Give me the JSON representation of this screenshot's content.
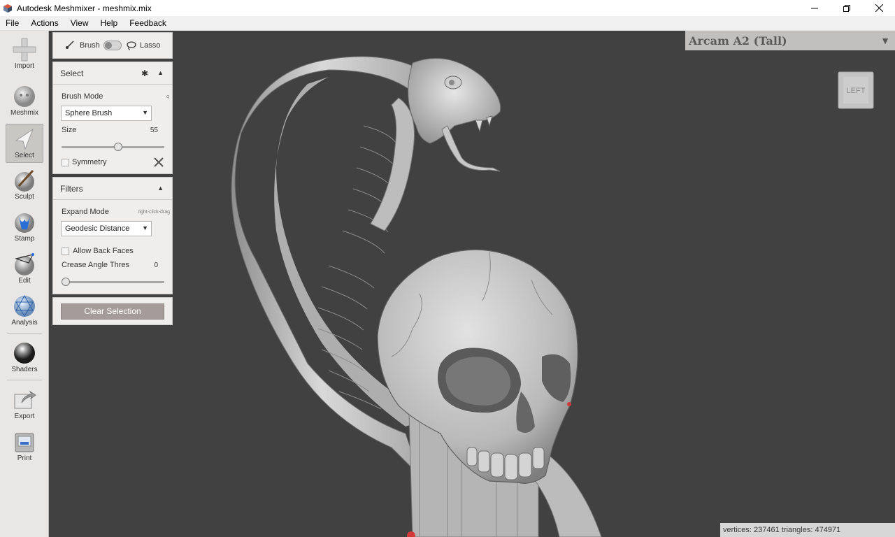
{
  "window": {
    "title": "Autodesk Meshmixer - meshmix.mix",
    "controls": [
      "minimize",
      "restore",
      "close"
    ]
  },
  "menu": [
    "File",
    "Actions",
    "View",
    "Help",
    "Feedback"
  ],
  "toolbar": {
    "tools": [
      {
        "label": "Import",
        "icon": "plus-icon"
      },
      {
        "label": "Meshmix",
        "icon": "meshmix-head-icon"
      },
      {
        "label": "Select",
        "icon": "cursor-arrow-icon",
        "active": true
      },
      {
        "label": "Sculpt",
        "icon": "brush-sphere-icon"
      },
      {
        "label": "Stamp",
        "icon": "stamp-icon"
      },
      {
        "label": "Edit",
        "icon": "edit-sphere-icon"
      },
      {
        "label": "Analysis",
        "icon": "analysis-sphere-icon"
      },
      {
        "label": "Shaders",
        "icon": "shader-sphere-icon"
      },
      {
        "label": "Export",
        "icon": "export-icon"
      },
      {
        "label": "Print",
        "icon": "printer-icon"
      }
    ]
  },
  "brush_toggle": {
    "left": "Brush",
    "right": "Lasso"
  },
  "select_panel": {
    "title": "Select",
    "brush_mode_label": "Brush Mode",
    "brush_mode_hotkey": "q",
    "brush_mode_value": "Sphere Brush",
    "size_label": "Size",
    "size_value": "55",
    "size_fraction": 0.55,
    "symmetry_label": "Symmetry",
    "symmetry_checked": false
  },
  "filters_panel": {
    "title": "Filters",
    "expand_mode_label": "Expand Mode",
    "expand_mode_hint": "right-click-drag",
    "expand_mode_value": "Geodesic Distance",
    "allow_back_faces_label": "Allow Back Faces",
    "allow_back_faces_checked": false,
    "crease_label": "Crease Angle Thres",
    "crease_value": "0",
    "crease_fraction": 0.0
  },
  "clear_button": "Clear Selection",
  "viewport": {
    "printer": "Arcam A2 (Tall)",
    "view_cube_face": "LEFT",
    "stats": "vertices: 237461 triangles: 474971"
  },
  "colors": {
    "viewport_bg": "#414141",
    "panel_bg": "#efeeec",
    "toolbar_bg": "#e8e7e5",
    "clear_button": "#a59c99",
    "model": "#cfcfcf"
  }
}
